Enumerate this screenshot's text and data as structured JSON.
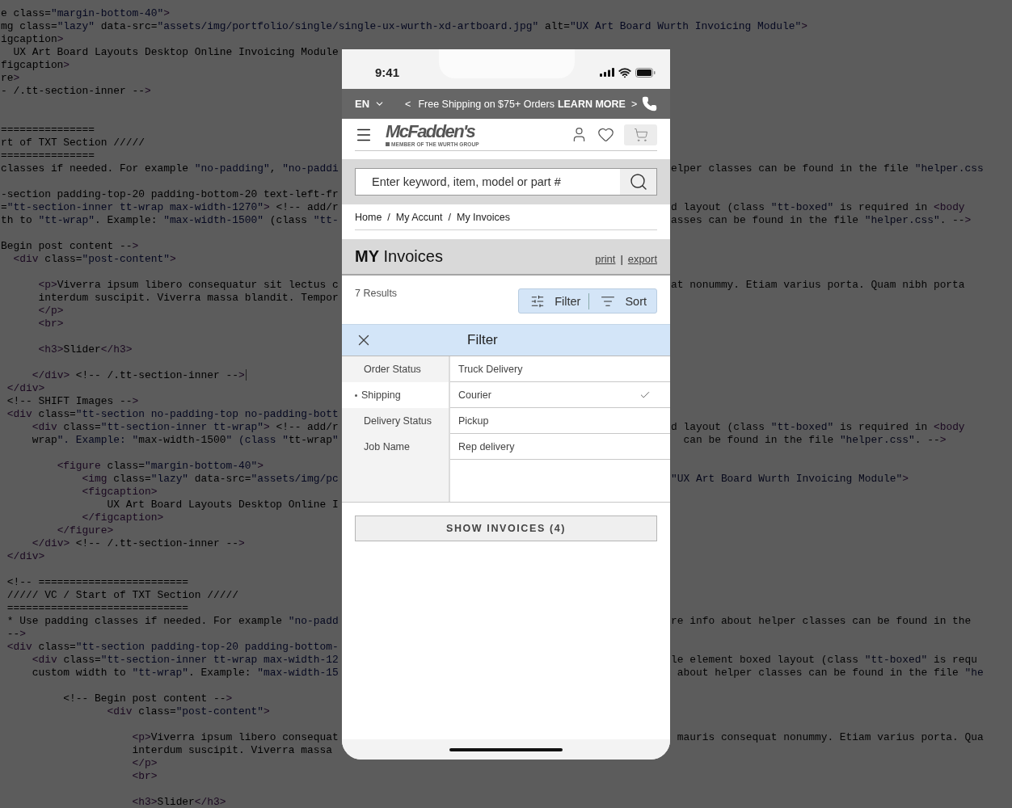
{
  "code_lines": [
    {
      "kind": "full",
      "text": "e class=\"margin-bottom-40\">"
    },
    {
      "kind": "full",
      "text": "mg class=\"lazy\" data-src=\"assets/img/portfolio/single/single-ux-wurth-xd-artboard.jpg\" alt=\"UX Art Board Wurth Invoicing Module\">"
    },
    {
      "kind": "full",
      "text": "igcaption>"
    },
    {
      "kind": "split",
      "left": "  UX Art Board Layouts Desktop Online Invoicing Module"
    },
    {
      "kind": "split",
      "left": "figcaption>"
    },
    {
      "kind": "split",
      "left": "re>"
    },
    {
      "kind": "split",
      "left": "- /.tt-section-inner -->"
    },
    {
      "kind": "blank"
    },
    {
      "kind": "blank"
    },
    {
      "kind": "split",
      "left": "==============="
    },
    {
      "kind": "split",
      "left": "rt of TXT Section /////"
    },
    {
      "kind": "split",
      "left": "==============="
    },
    {
      "kind": "split",
      "left": "classes if needed. For example \"no-padding\", \"no-paddi",
      "right": "elper classes can be found in the file \"helper.css"
    },
    {
      "kind": "blank"
    },
    {
      "kind": "split",
      "left": "-section padding-top-20 padding-bottom-20 text-left-fr"
    },
    {
      "kind": "split",
      "left": "=\"tt-section-inner tt-wrap max-width-1270\"> <!-- add/r",
      "right": "d layout (class \"tt-boxed\" is required in <body"
    },
    {
      "kind": "split",
      "left": "th to \"tt-wrap\". Example: \"max-width-1500\" (class \"tt-",
      "right": "asses can be found in the file \"helper.css\". -->"
    },
    {
      "kind": "blank"
    },
    {
      "kind": "split",
      "left": "Begin post content -->"
    },
    {
      "kind": "split",
      "left": "  <div class=\"post-content\">"
    },
    {
      "kind": "blank"
    },
    {
      "kind": "split",
      "left": "      <p>Viverra ipsum libero consequatur sit lectus c",
      "right": "at nonummy. Etiam varius porta. Quam nibh porta"
    },
    {
      "kind": "split",
      "left": "      interdum suscipit. Viverra massa blandit. Tempor"
    },
    {
      "kind": "split",
      "left": "      </p>"
    },
    {
      "kind": "split",
      "left": "      <br>"
    },
    {
      "kind": "blank"
    },
    {
      "kind": "split",
      "left": "      <h3>Slider</h3>"
    },
    {
      "kind": "blank"
    },
    {
      "kind": "split",
      "left": "     </div> <!-- /.tt-section-inner -->",
      "cursor": true
    },
    {
      "kind": "split",
      "left": " </div>"
    },
    {
      "kind": "split",
      "left": " <!-- SHIFT Images -->"
    },
    {
      "kind": "split",
      "left": " <div class=\"tt-section no-padding-top no-padding-bott"
    },
    {
      "kind": "split",
      "left": "     <div class=\"tt-section-inner tt-wrap\"> <!-- add/r",
      "right": "d layout (class \"tt-boxed\" is required in <body"
    },
    {
      "kind": "split",
      "left": "     wrap\". Example: \"max-width-1500\" (class \"tt-wrap\"",
      "right": "  can be found in the file \"helper.css\". -->"
    },
    {
      "kind": "blank"
    },
    {
      "kind": "split",
      "left": "         <figure class=\"margin-bottom-40\">"
    },
    {
      "kind": "split",
      "left": "             <img class=\"lazy\" data-src=\"assets/img/pc",
      "right": "\"UX Art Board Wurth Invoicing Module\">"
    },
    {
      "kind": "split",
      "left": "             <figcaption>"
    },
    {
      "kind": "split",
      "left": "                 UX Art Board Layouts Desktop Online I"
    },
    {
      "kind": "split",
      "left": "             </figcaption>"
    },
    {
      "kind": "split",
      "left": "         </figure>"
    },
    {
      "kind": "split",
      "left": "     </div> <!-- /.tt-section-inner -->"
    },
    {
      "kind": "split",
      "left": " </div>"
    },
    {
      "kind": "blank"
    },
    {
      "kind": "split",
      "left": " <!-- ========================"
    },
    {
      "kind": "split",
      "left": " ///// VC / Start of TXT Section /////"
    },
    {
      "kind": "split",
      "left": " ============================="
    },
    {
      "kind": "split",
      "left": " * Use padding classes if needed. For example \"no-padd",
      "right": "re info about helper classes can be found in the"
    },
    {
      "kind": "split",
      "left": " -->"
    },
    {
      "kind": "split",
      "left": " <div class=\"tt-section padding-top-20 padding-bottom-"
    },
    {
      "kind": "split",
      "left": "     <div class=\"tt-section-inner tt-wrap max-width-12",
      "right": "le element boxed layout (class \"tt-boxed\" is requ"
    },
    {
      "kind": "split",
      "left": "     custom width to \"tt-wrap\". Example: \"max-width-15",
      "right": " about helper classes can be found in the file \"he"
    },
    {
      "kind": "blank"
    },
    {
      "kind": "split",
      "left": "          <!-- Begin post content -->"
    },
    {
      "kind": "split",
      "left": "                 <div class=\"post-content\">"
    },
    {
      "kind": "blank"
    },
    {
      "kind": "split",
      "left": "                     <p>Viverra ipsum libero consequat",
      "right": " mauris consequat nonummy. Etiam varius porta. Qua"
    },
    {
      "kind": "split",
      "left": "                     interdum suscipit. Viverra massa"
    },
    {
      "kind": "split",
      "left": "                     </p>"
    },
    {
      "kind": "split",
      "left": "                     <br>"
    },
    {
      "kind": "blank"
    },
    {
      "kind": "split",
      "left": "                     <h3>Slider</h3>"
    }
  ],
  "phone": {
    "status_bar": {
      "time": "9:41"
    },
    "promo_bar": {
      "language": "EN",
      "prev": "<",
      "message": "Free Shipping on $75+ Orders",
      "link": "LEARN MORE",
      "next": ">"
    },
    "header": {
      "logo": "McFadden's",
      "tagline": "MEMBER OF THE WURTH GROUP"
    },
    "search": {
      "placeholder": "Enter keyword, item, model or part #"
    },
    "breadcrumb": {
      "separator": "/",
      "items": [
        "Home",
        "My Accunt",
        "My Invoices"
      ]
    },
    "page_title": "**MY** Invoices",
    "actions": {
      "separator": "|",
      "items": [
        "print",
        "export"
      ]
    },
    "results": "7 Results",
    "toolbar": [
      {
        "kind": "filter",
        "label": "Filter"
      },
      {
        "kind": "sort",
        "label": "Sort"
      }
    ],
    "filter_panel": {
      "title": "Filter",
      "categories": [
        {
          "label": "Order Status",
          "selected": false
        },
        {
          "label": "Shipping",
          "selected": true
        },
        {
          "label": "Delivery Status",
          "selected": false
        },
        {
          "label": "Job Name",
          "selected": false
        }
      ],
      "options": [
        {
          "label": "Truck Delivery",
          "checked": false
        },
        {
          "label": "Courier",
          "checked": true
        },
        {
          "label": "Pickup",
          "checked": false
        },
        {
          "label": "Rep delivery",
          "checked": false
        }
      ]
    },
    "apply_button": "SHOW INVOICES (4)"
  }
}
